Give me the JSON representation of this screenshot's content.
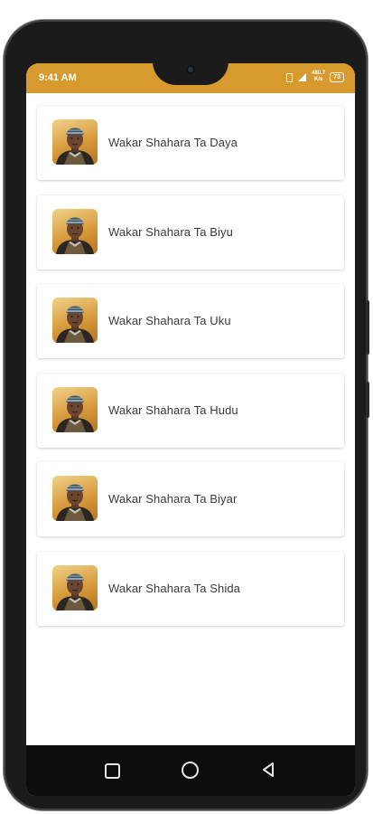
{
  "status_bar": {
    "time": "9:41 AM",
    "net_speed_value": "480.7",
    "net_speed_unit": "K/s",
    "battery": "73",
    "background_color": "#d79a2e"
  },
  "songs": [
    {
      "title": "Wakar Shahara Ta Daya"
    },
    {
      "title": "Wakar Shahara Ta Biyu"
    },
    {
      "title": "Wakar Shahara Ta Uku"
    },
    {
      "title": "Wakar Shahara Ta Hudu"
    },
    {
      "title": "Wakar Shahara Ta Biyar"
    },
    {
      "title": "Wakar Shahara Ta Shida"
    }
  ],
  "nav_bar": {
    "recents_icon": "square-icon",
    "home_icon": "circle-icon",
    "back_icon": "triangle-back-icon"
  }
}
